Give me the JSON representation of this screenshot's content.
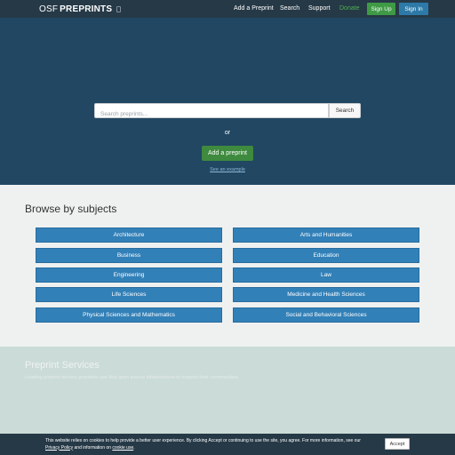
{
  "navbar": {
    "brand_osf": "OSF",
    "brand_preprints": "PREPRINTS",
    "links": [
      "Add a Preprint",
      "Search",
      "Support",
      "Donate"
    ],
    "signup_label": "Sign Up",
    "signin_label": "Sign In",
    "donate_color": "#4caf50"
  },
  "hero": {
    "search_placeholder": "Search preprints...",
    "search_button": "Search",
    "or_text": "or",
    "add_button": "Add a preprint",
    "example_link": "See an example"
  },
  "subjects": {
    "title": "Browse by subjects",
    "items": [
      "Architecture",
      "Arts and Humanities",
      "Business",
      "Education",
      "Engineering",
      "Law",
      "Life Sciences",
      "Medicine and Health Sciences",
      "Physical Sciences and Mathematics",
      "Social and Behavioral Sciences"
    ]
  },
  "services": {
    "title": "Preprint Services",
    "description": "Leading preprint service providers use this open source infrastructure to support their communities."
  },
  "cookie": {
    "text_before": "This website relies on cookies to help provide a better user experience. By clicking Accept or continuing to use the site, you agree. For more information, see our ",
    "privacy_link": "Privacy Policy",
    "text_middle": " and information on ",
    "cookie_link": "cookie use",
    "text_after": ".",
    "accept_label": "Accept"
  },
  "colors": {
    "navbar": "#263947",
    "hero": "#214762",
    "subject_button": "#3280b8",
    "signup": "#3e9a45",
    "signin": "#2d7aa8"
  }
}
